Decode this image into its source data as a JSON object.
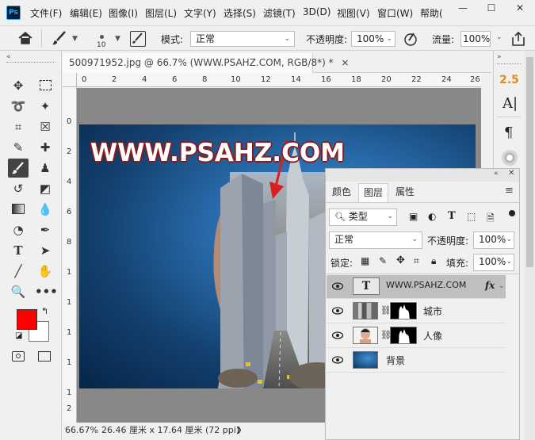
{
  "menubar": {
    "logo": "Ps",
    "items": [
      "文件(F)",
      "编辑(E)",
      "图像(I)",
      "图层(L)",
      "文字(Y)",
      "选择(S)",
      "滤镜(T)",
      "3D(D)",
      "视图(V)",
      "窗口(W)",
      "帮助("
    ],
    "window_buttons": [
      "—",
      "☐",
      "✕"
    ]
  },
  "options": {
    "brush_size": "10",
    "mode_label": "模式:",
    "mode_value": "正常",
    "opacity_label": "不透明度:",
    "opacity_value": "100%",
    "flow_label": "流量:",
    "flow_value": "100%"
  },
  "document": {
    "tab_title": "500971952.jpg @ 66.7% (WWW.PSAHZ.COM, RGB/8*) *",
    "close": "×",
    "canvas_text": "WWW.PSAHZ.COM",
    "ruler_h": [
      "0",
      "2",
      "4",
      "6",
      "8",
      "10",
      "12",
      "14",
      "16",
      "18",
      "20",
      "22",
      "24",
      "26"
    ],
    "ruler_v": [
      "0",
      "2",
      "4",
      "6",
      "8",
      "1",
      "1",
      "1",
      "1",
      "1",
      "2"
    ]
  },
  "status": {
    "zoom": "66.67%",
    "size": "26.46 厘米 x 17.64 厘米 (72 ppi)"
  },
  "rightstrip": {
    "version_value": "2.5"
  },
  "layers_panel": {
    "tabs": [
      "颜色",
      "图层",
      "属性"
    ],
    "kind_label": "类型",
    "blend_mode": "正常",
    "opacity_label": "不透明度:",
    "opacity_value": "100%",
    "lock_label": "锁定:",
    "fill_label": "填充:",
    "fill_value": "100%",
    "fx": "fx",
    "text_thumb": "T",
    "layers": [
      "WWW.PSAHZ.COM",
      "城市",
      "人像",
      "背景"
    ]
  }
}
